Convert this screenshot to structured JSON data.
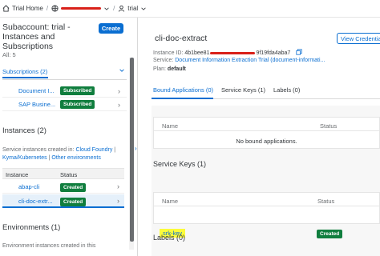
{
  "breadcrumb": {
    "home": "Trial Home",
    "subaccount": "trial"
  },
  "left": {
    "header": "Subaccount: trial - Instances and Subscriptions",
    "all_count": "All: 5",
    "create_label": "Create",
    "subscriptions_tab": "Subscriptions (2)",
    "subscriptions": [
      {
        "name": "Document I...",
        "status": "Subscribed"
      },
      {
        "name": "SAP Busine...",
        "status": "Subscribed"
      }
    ],
    "instances_title": "Instances (2)",
    "instances_desc_prefix": "Service instances created in: ",
    "instances_desc_link1": "Cloud Foundry",
    "instances_desc_sep": " | ",
    "instances_desc_link2": "Kyma/Kubernetes",
    "instances_desc_link3": "Other environments",
    "table_headers": {
      "instance": "Instance",
      "status": "Status"
    },
    "instances": [
      {
        "name": "abap-cli",
        "status": "Created"
      },
      {
        "name": "cli-doc-extr...",
        "status": "Created"
      }
    ],
    "environments_title": "Environments (1)",
    "environments_desc": "Environment instances created in this"
  },
  "detail": {
    "title": "cli-doc-extract",
    "view_credentials_label": "View Credentials",
    "instance_id_label": "Instance ID:",
    "instance_id_start": "4b1bee81",
    "instance_id_end": "9f19fda4aba7",
    "service_label": "Service:",
    "service_value": "Document Information Extraction Trial (document-informati...",
    "plan_label": "Plan:",
    "plan_value": "default",
    "tabs": [
      "Bound Applications (0)",
      "Service Keys (1)",
      "Labels (0)"
    ],
    "bound_table_headers": {
      "name": "Name",
      "status": "Status"
    },
    "bound_empty": "No bound applications.",
    "service_keys_title": "Service Keys (1)",
    "keys_table_headers": {
      "name": "Name",
      "status": "Status"
    },
    "keys": [
      {
        "name": "srk-key",
        "status": "Created"
      }
    ],
    "labels_title": "Labels (0)"
  },
  "colors": {
    "accent": "#0a6ed1",
    "success": "#107e3e",
    "highlight": "#fcfc3a",
    "redaction": "#d9211a"
  }
}
